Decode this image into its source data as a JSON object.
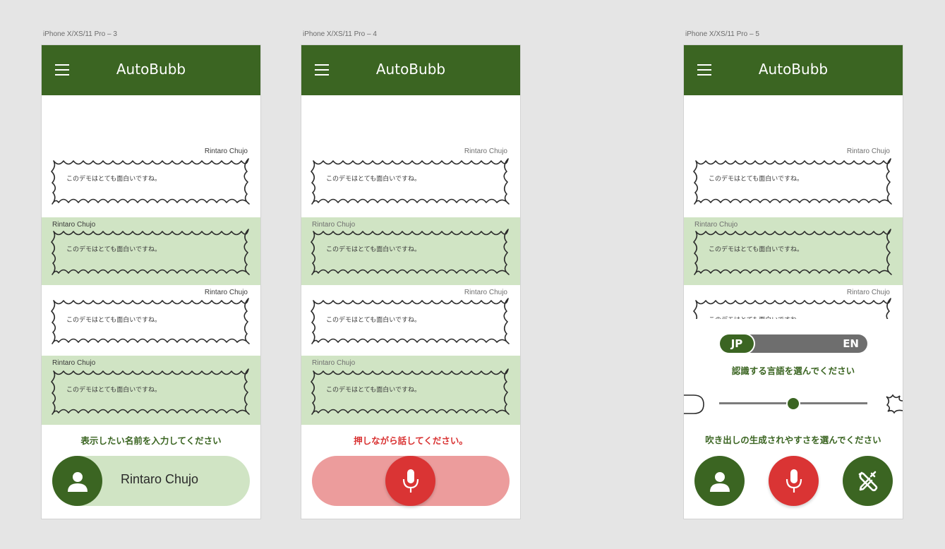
{
  "artboards": [
    {
      "label": "iPhone X/XS/11 Pro – 3"
    },
    {
      "label": "iPhone X/XS/11 Pro – 4"
    },
    {
      "label": "iPhone X/XS/11 Pro – 5"
    }
  ],
  "app": {
    "title": "AutoBubb"
  },
  "bubble": {
    "speaker": "Rintaro Chujo",
    "text": "このデモはとても面白いですね。"
  },
  "screen3": {
    "prompt": "表示したい名前を入力してください",
    "name_value": "Rintaro Chujo"
  },
  "screen4": {
    "prompt": "押しながら話してください。"
  },
  "screen5": {
    "lang_jp": "JP",
    "lang_en": "EN",
    "lang_selected": "JP",
    "lang_prompt": "認識する言語を選んでください",
    "sensitivity_level": 0.5,
    "sensitivity_prompt": "吹き出しの生成されやすさを選んでください"
  },
  "colors": {
    "primary_green": "#3b6522",
    "light_green": "#d0e4c4",
    "accent_red": "#da3434",
    "light_red": "#ec9c9c"
  },
  "icons": [
    "hamburger-icon",
    "user-icon",
    "microphone-icon",
    "tools-icon"
  ]
}
